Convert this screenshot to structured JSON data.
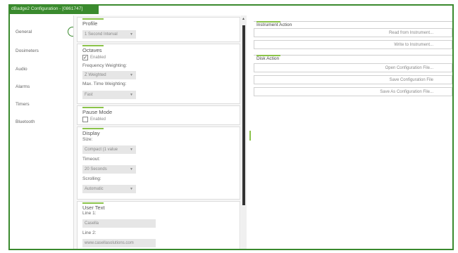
{
  "window": {
    "title": "dBadge2 Configuration - [0861747]"
  },
  "nav": {
    "items": [
      {
        "label": "General"
      },
      {
        "label": "Dosimeters"
      },
      {
        "label": "Audio"
      },
      {
        "label": "Alarms"
      },
      {
        "label": "Timers"
      },
      {
        "label": "Bluetooth"
      }
    ]
  },
  "profile": {
    "title": "Profile",
    "value": "1 Second Interval"
  },
  "octaves": {
    "title": "Octaves",
    "enabled_label": "Enabled",
    "enabled_mark": "✓",
    "freq_label": "Frequency Weighting:",
    "freq_value": "Z Weighted",
    "time_label": "Max. Time Weighting:",
    "time_value": "Fast"
  },
  "pause": {
    "title": "Pause Mode",
    "enabled_label": "Enabled"
  },
  "display": {
    "title": "Display",
    "size_label": "Size:",
    "size_value": "Compact (1 value",
    "timeout_label": "Timeout:",
    "timeout_value": "20 Seconds",
    "scrolling_label": "Scrolling:",
    "scrolling_value": "Automatic"
  },
  "user_text": {
    "title": "User Text",
    "line1_label": "Line 1:",
    "line1_value": "Casella",
    "line2_label": "Line 2:",
    "line2_value": "www.casellasolutions.com"
  },
  "instrument_action": {
    "title": "Instrument Action",
    "read": "Read from Instrument...",
    "write": "Write to Instrument..."
  },
  "disk_action": {
    "title": "Disk Action",
    "open": "Open Configuration File...",
    "save": "Save Configuration File",
    "save_as": "Save As Configuration File..."
  },
  "icons": {
    "chevron": "chevron-down-icon",
    "scroll_up": "scroll-up-icon"
  },
  "colors": {
    "accent": "#3a8a2e",
    "highlight": "#8bc34a"
  }
}
